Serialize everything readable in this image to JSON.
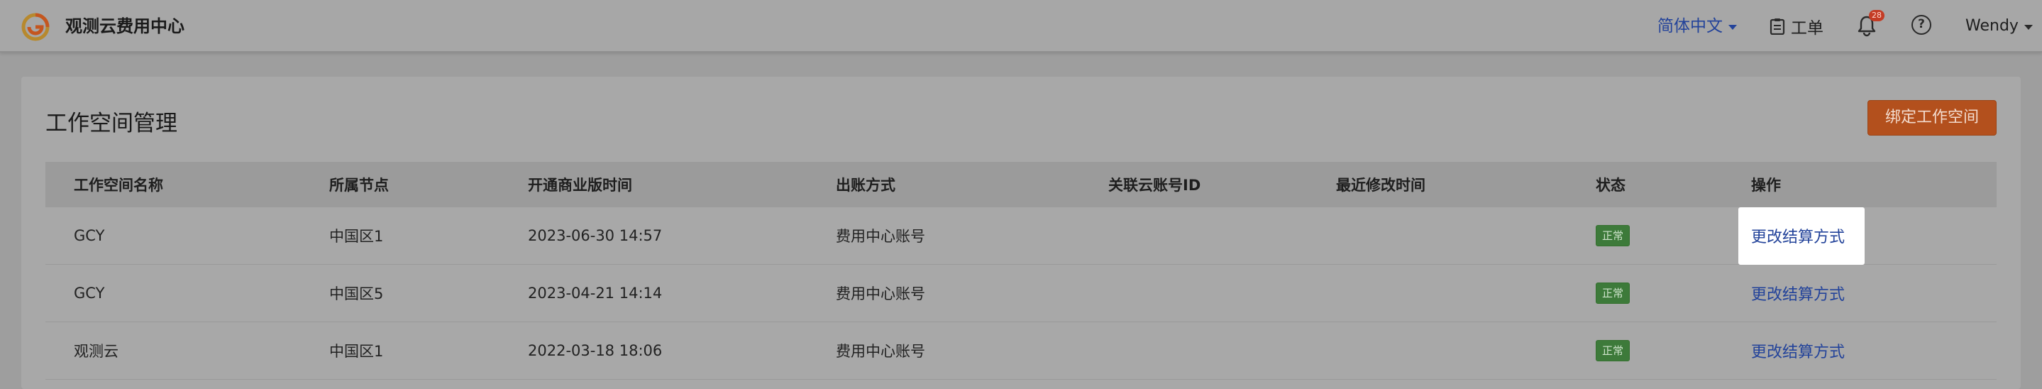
{
  "header": {
    "app_title": "观测云费用中心",
    "language_label": "简体中文",
    "ticket_label": "工单",
    "notification_count": "28",
    "help_label": "?",
    "user_name": "Wendy"
  },
  "page": {
    "title": "工作空间管理",
    "bind_button_label": "绑定工作空间"
  },
  "table": {
    "columns": [
      "工作空间名称",
      "所属节点",
      "开通商业版时间",
      "出账方式",
      "关联云账号ID",
      "最近修改时间",
      "状态",
      "操作"
    ],
    "rows": [
      {
        "name": "GCY",
        "node": "中国区1",
        "opened": "2023-06-30 14:57",
        "billing": "费用中心账号",
        "cloud_id": "",
        "modified": "",
        "status": "正常",
        "action": "更改结算方式"
      },
      {
        "name": "GCY",
        "node": "中国区5",
        "opened": "2023-04-21 14:14",
        "billing": "费用中心账号",
        "cloud_id": "",
        "modified": "",
        "status": "正常",
        "action": "更改结算方式"
      },
      {
        "name": "观测云",
        "node": "中国区1",
        "opened": "2022-03-18 18:06",
        "billing": "费用中心账号",
        "cloud_id": "",
        "modified": "",
        "status": "正常",
        "action": "更改结算方式"
      }
    ]
  },
  "icons": {
    "logo": "guance-logo-icon",
    "ticket": "clipboard-icon",
    "bell": "bell-icon",
    "help": "question-circle-icon"
  },
  "colors": {
    "accent_orange": "#b3501d",
    "link_blue": "#23439a",
    "status_green": "#3d7a3a",
    "badge_red": "#c43c25"
  }
}
